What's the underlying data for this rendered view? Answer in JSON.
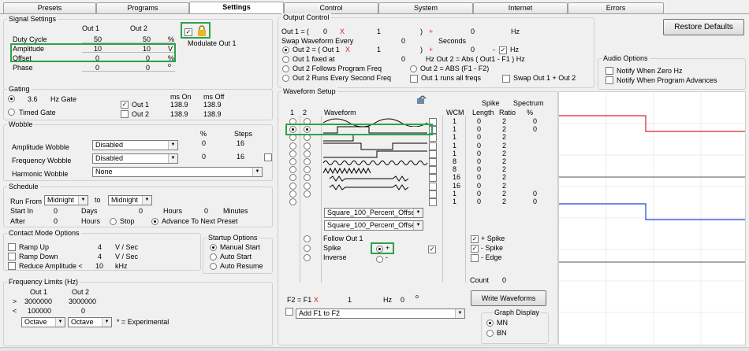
{
  "tabs": [
    "Presets",
    "Programs",
    "Settings",
    "Control",
    "System",
    "Internet",
    "Errors"
  ],
  "signal": {
    "title": "Signal Settings",
    "out1": "Out 1",
    "out2": "Out 2",
    "rows": [
      {
        "label": "Duty Cycle",
        "v1": "50",
        "v2": "50",
        "unit": "%"
      },
      {
        "label": "Amplitude",
        "v1": "10",
        "v2": "10",
        "unit": "V"
      },
      {
        "label": "Offset",
        "v1": "0",
        "v2": "0",
        "unit": "%"
      },
      {
        "label": "Phase",
        "v1": "0",
        "v2": "0",
        "unit": "o"
      }
    ],
    "modulate": "Modulate Out 1"
  },
  "gating": {
    "title": "Gating",
    "hz_val": "3.6",
    "hz_gate": "Hz Gate",
    "timed": "Timed Gate",
    "ms_on": "ms On",
    "ms_off": "ms Off",
    "out1": "Out 1",
    "out2": "Out 2",
    "on1": "138.9",
    "off1": "138.9",
    "on2": "138.9",
    "off2": "138.9"
  },
  "wobble": {
    "title": "Wobble",
    "pct": "%",
    "steps": "Steps",
    "amp_label": "Amplitude Wobble",
    "amp_sel": "Disabled",
    "amp_pct": "0",
    "amp_steps": "16",
    "freq_label": "Frequency Wobble",
    "freq_sel": "Disabled",
    "freq_pct": "0",
    "freq_steps": "16",
    "harm_label": "Harmonic Wobble",
    "harm_sel": "None"
  },
  "schedule": {
    "title": "Schedule",
    "run_from": "Run From",
    "from_sel": "Midnight",
    "to": "to",
    "to_sel": "Midnight",
    "start_in": "Start In",
    "start_v": "0",
    "days": "Days",
    "days_v": "0",
    "hours": "Hours",
    "hours_v": "0",
    "minutes": "Minutes",
    "after": "After",
    "after_v": "0",
    "hours2": "Hours",
    "stop": "Stop",
    "advance": "Advance To Next Preset"
  },
  "contact": {
    "title": "Contact Mode Options",
    "ramp_up": "Ramp Up",
    "ramp_up_v": "4",
    "ramp_down": "Ramp Down",
    "ramp_down_v": "4",
    "vsec": "V / Sec",
    "reduce": "Reduce Amplitude <",
    "reduce_v": "10",
    "khz": "kHz"
  },
  "startup": {
    "title": "Startup Options",
    "manual": "Manual Start",
    "auto": "Auto Start",
    "resume": "Auto Resume"
  },
  "freq_limits": {
    "title": "Frequency Limits (Hz)",
    "out1": "Out 1",
    "out2": "Out 2",
    "gt": ">",
    "lt": "<",
    "max1": "3000000",
    "max2": "3000000",
    "min1": "100000",
    "min2": "0",
    "sel1": "Octave",
    "sel2": "Octave",
    "note": "* = Experimental"
  },
  "output": {
    "title": "Output Control",
    "l1a": "Out 1 =",
    "l1b": "(",
    "l1c": "0",
    "x": "X",
    "l1d": "1",
    "l1e": ")",
    "plus": "+",
    "l1f": "0",
    "hz": "Hz",
    "swap": "Swap Waveform Every",
    "swap_v": "0",
    "seconds": "Seconds",
    "o2a": "Out 2 = ( Out 1",
    "o2b": "1",
    "o2c": ")",
    "o2d": "0",
    "minus": "-",
    "hz2": "Hz",
    "fixed": "Out 1 fixed at",
    "fixed_v": "0",
    "abs_text": "Hz  Out 2 = Abs ( Out1 - F1 ) Hz",
    "follows": "Out 2 Follows Program Freq",
    "abs2": "Out 2 = ABS (F1 - F2)",
    "runs": "Out 2 Runs Every Second Freq",
    "allfreqs": "Out 1 runs all freqs",
    "swap12": "Swap Out 1 + Out 2"
  },
  "restore": "Restore Defaults",
  "audio": {
    "title": "Audio Options",
    "zero": "Notify When Zero Hz",
    "advance": "Notify When Program Advances"
  },
  "wave": {
    "title": "Waveform Setup",
    "c1": "1",
    "c2": "2",
    "waveform": "Waveform",
    "wcm": "WCM",
    "spike": "Spike",
    "length": "Length",
    "ratio": "Ratio",
    "spectrum": "Spectrum",
    "pct": "%",
    "rows": [
      {
        "w": "1",
        "l": "0",
        "r": "2",
        "s": "0"
      },
      {
        "w": "1",
        "l": "0",
        "r": "2",
        "s": "0"
      },
      {
        "w": "1",
        "l": "0",
        "r": "2",
        "s": ""
      },
      {
        "w": "1",
        "l": "0",
        "r": "2",
        "s": ""
      },
      {
        "w": "1",
        "l": "0",
        "r": "2",
        "s": ""
      },
      {
        "w": "8",
        "l": "0",
        "r": "2",
        "s": ""
      },
      {
        "w": "8",
        "l": "0",
        "r": "2",
        "s": ""
      },
      {
        "w": "16",
        "l": "0",
        "r": "2",
        "s": ""
      },
      {
        "w": "16",
        "l": "0",
        "r": "2",
        "s": ""
      },
      {
        "w": "1",
        "l": "0",
        "r": "2",
        "s": "0"
      },
      {
        "w": "1",
        "l": "0",
        "r": "2",
        "s": "0"
      }
    ],
    "sel1": "Square_100_Percent_Offset",
    "sel2": "Square_100_Percent_Offset",
    "follow": "Follow Out 1",
    "spike_opt": "Spike",
    "inverse": "Inverse",
    "plus": "+",
    "minus": "-",
    "pspike": "+ Spike",
    "mspike": "- Spike",
    "edge": "- Edge",
    "count": "Count",
    "count_v": "0"
  },
  "f2": {
    "label": "F2 = F1",
    "x": "X",
    "v": "1",
    "hz": "Hz",
    "deg": "0",
    "o": "o"
  },
  "write": "Write Waveforms",
  "addf": "Add F1 to F2",
  "graph": {
    "title": "Graph Display",
    "mn": "MN",
    "bn": "BN"
  },
  "colors": {
    "highlight": "#2ca24a",
    "red_trace": "#e02020",
    "blue_trace": "#1f3fdf"
  }
}
